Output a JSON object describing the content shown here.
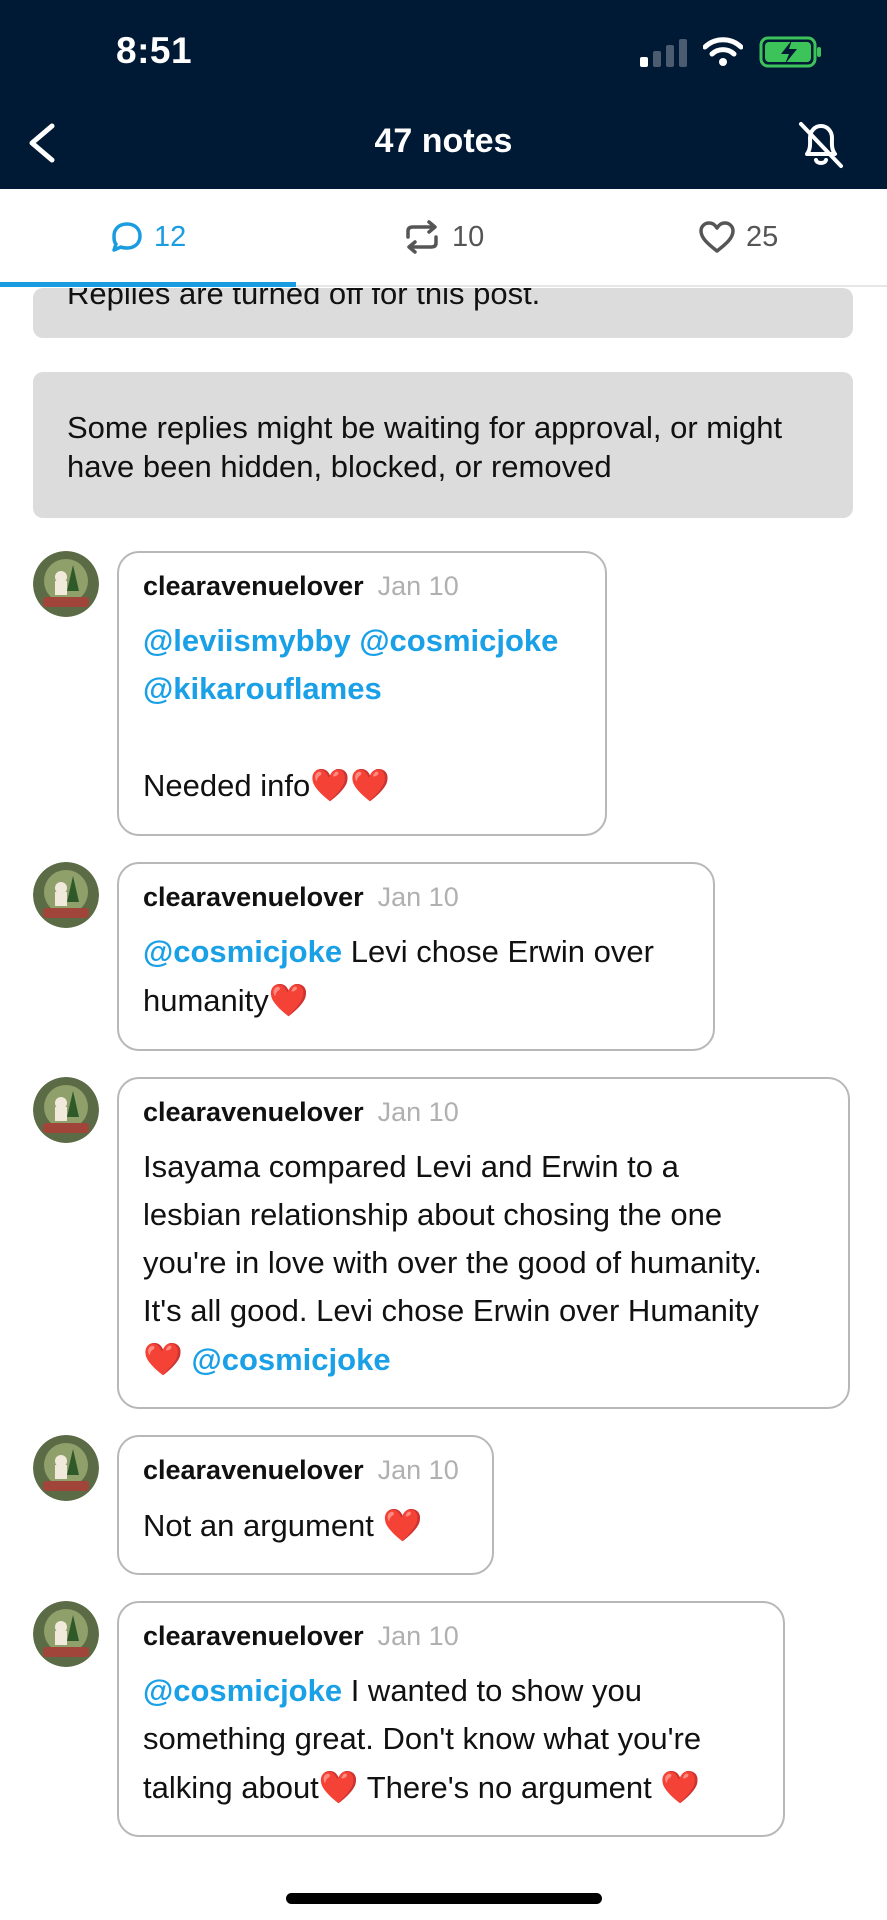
{
  "status_bar": {
    "time": "8:51"
  },
  "nav": {
    "title": "47 notes"
  },
  "tabs": [
    {
      "name": "replies",
      "count": "12"
    },
    {
      "name": "reblogs",
      "count": "10"
    },
    {
      "name": "likes",
      "count": "25"
    }
  ],
  "notices": {
    "cut_text": "Replies are turned off for this post.",
    "main_text": "Some replies might be waiting for approval, or might have been hidden, blocked, or removed"
  },
  "replies": [
    {
      "username": "clearavenuelover",
      "date": "Jan 10",
      "mention_1": "@leviismybby @cosmicjoke",
      "mention_2": "@kikarouflames",
      "text": "Needed info",
      "hearts": "❤️❤️"
    },
    {
      "username": "clearavenuelover",
      "date": "Jan 10",
      "mention": "@cosmicjoke",
      "text_1": " Levi chose Erwin over",
      "text_2": "humanity",
      "hearts": "❤️"
    },
    {
      "username": "clearavenuelover",
      "date": "Jan 10",
      "lines": [
        "Isayama compared Levi and Erwin to a",
        "lesbian relationship about chosing the one",
        "you're in love with over the good of humanity.",
        "It's all good. Levi chose Erwin over Humanity"
      ],
      "hearts": "❤️",
      "mention": "@cosmicjoke"
    },
    {
      "username": "clearavenuelover",
      "date": "Jan 10",
      "text": "Not an argument ",
      "hearts": "❤️"
    },
    {
      "username": "clearavenuelover",
      "date": "Jan 10",
      "mention": "@cosmicjoke",
      "text_1": " I wanted to show you",
      "text_2": "something great. Don't know what you're",
      "text_3": "talking about",
      "hearts_a": "❤️",
      "text_4": " There's no argument ",
      "hearts_b": "❤️"
    }
  ],
  "colors": {
    "header_bg": "#001935",
    "accent": "#1a9ce0",
    "notice_bg": "#dcdcdc",
    "heart": "#e01b24"
  },
  "icons": {
    "back": "chevron-left-icon",
    "bell": "bell-off-icon",
    "replies_tab": "speech-bubble-icon",
    "reblogs_tab": "reblog-icon",
    "likes_tab": "heart-outline-icon"
  }
}
